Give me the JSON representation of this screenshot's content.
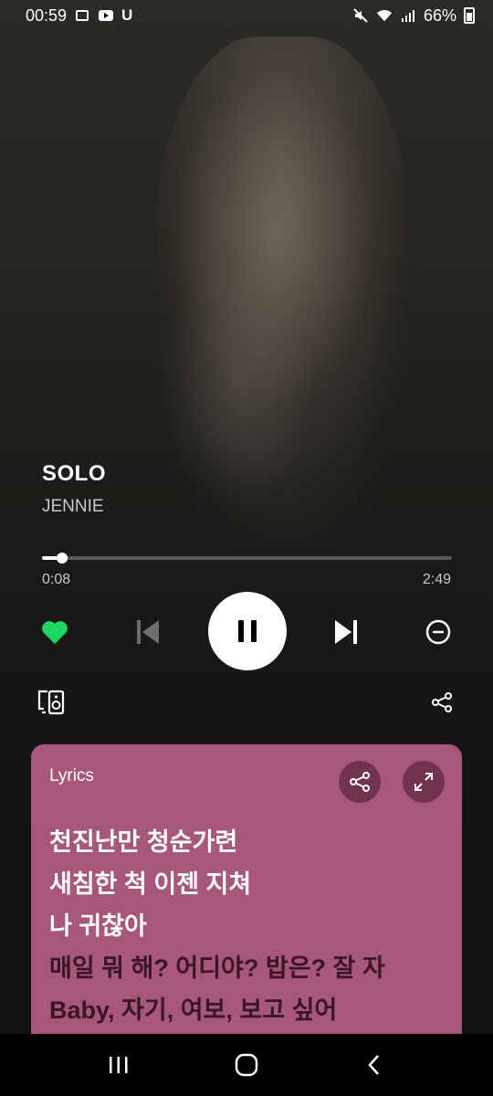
{
  "status_bar": {
    "time": "00:59",
    "battery": "66%",
    "left_icons": [
      "gallery-icon",
      "youtube-icon",
      "u-icon"
    ],
    "right_icons": [
      "mute-icon",
      "wifi-icon",
      "signal-icon",
      "battery-icon"
    ],
    "u_label": "U"
  },
  "track": {
    "title": "SOLO",
    "artist": "JENNIE",
    "current_time": "0:08",
    "total_time": "2:49",
    "progress_fraction": 0.048,
    "liked": true
  },
  "controls": {
    "like": "heart-icon",
    "previous": "skip-previous-icon",
    "play_pause": "pause-icon",
    "next": "skip-next-icon",
    "remove": "minus-circle-icon",
    "devices": "connect-device-icon",
    "share": "share-icon"
  },
  "lyrics": {
    "label": "Lyrics",
    "lines": [
      {
        "text": "천진난만 청순가련",
        "state": "past"
      },
      {
        "text": "새침한 척 이젠 지쳐",
        "state": "past"
      },
      {
        "text": "나 귀찮아",
        "state": "past"
      },
      {
        "text": "매일 뭐 해? 어디야? 밥은? 잘 자",
        "state": "future"
      },
      {
        "text": "Baby, 자기, 여보, 보고 싶어",
        "state": "future"
      }
    ]
  },
  "colors": {
    "accent_green": "#1ed760",
    "lyrics_bg": "#a6577a",
    "lyrics_button_bg": "#71334e"
  },
  "nav_bar": {
    "icons": [
      "recent-apps-icon",
      "home-icon",
      "back-icon"
    ]
  }
}
